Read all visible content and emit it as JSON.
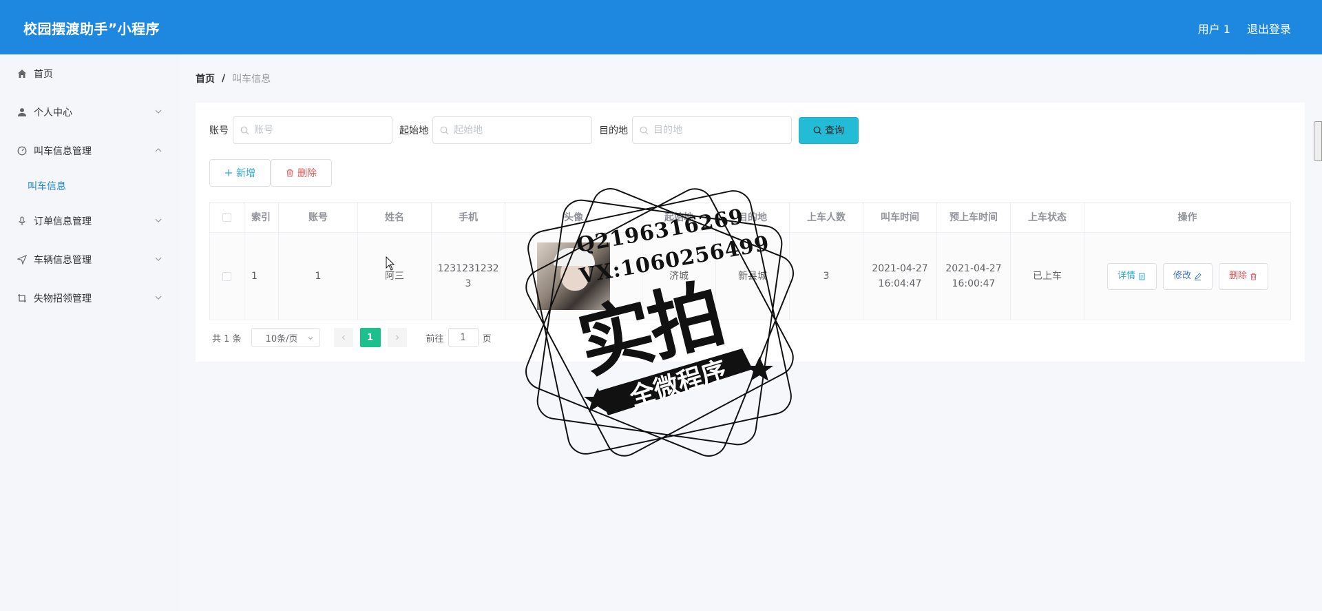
{
  "header": {
    "app_title": "校园摆渡助手”小程序",
    "user_label": "用户 1",
    "logout_label": "退出登录"
  },
  "sidebar": {
    "items": [
      {
        "label": "首页",
        "icon": "home-icon"
      },
      {
        "label": "个人中心",
        "icon": "user-icon"
      },
      {
        "label": "叫车信息管理",
        "icon": "dashboard-icon",
        "expanded": true,
        "children": [
          {
            "label": "叫车信息",
            "active": true
          }
        ]
      },
      {
        "label": "订单信息管理",
        "icon": "microphone-icon"
      },
      {
        "label": "车辆信息管理",
        "icon": "send-icon"
      },
      {
        "label": "失物招领管理",
        "icon": "crop-icon"
      }
    ]
  },
  "breadcrumb": {
    "home": "首页",
    "separator": "/",
    "current": "叫车信息"
  },
  "search": {
    "account_label": "账号",
    "account_placeholder": "账号",
    "start_label": "起始地",
    "start_placeholder": "起始地",
    "dest_label": "目的地",
    "dest_placeholder": "目的地",
    "query_label": "查询"
  },
  "actions": {
    "add_label": "新增",
    "delete_label": "删除"
  },
  "table": {
    "columns": [
      "",
      "索引",
      "账号",
      "姓名",
      "手机",
      "头像",
      "起始地",
      "目的地",
      "上车人数",
      "叫车时间",
      "预上车时间",
      "上车状态",
      "操作"
    ],
    "rows": [
      {
        "index": "1",
        "account": "1",
        "name": "阿三",
        "phone": "12312312323",
        "start": "济城",
        "dest": "新县城",
        "passengers": "3",
        "call_time": "2021-04-27 16:04:47",
        "board_time": "2021-04-27 16:00:47",
        "status": "已上车",
        "ops": {
          "detail": "详情",
          "edit": "修改",
          "remove": "删除"
        }
      }
    ]
  },
  "pagination": {
    "total": "共 1 条",
    "page_size": "10条/页",
    "current_page": "1",
    "goto_prefix": "前往",
    "goto_value": "1",
    "goto_suffix": "页"
  },
  "watermark": {
    "qq": "Q2196316269",
    "vx": "VX:1060256499",
    "main": "实拍",
    "sub": "全微程序"
  },
  "colors": {
    "header_bg": "#1e88e0",
    "query_btn": "#22bcd6",
    "page_active": "#1cc08a"
  }
}
